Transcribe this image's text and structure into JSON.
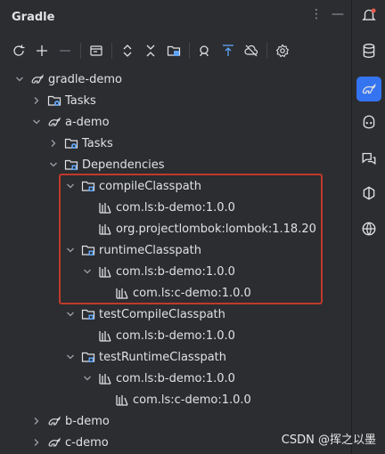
{
  "panel": {
    "title": "Gradle",
    "menu_icon": "more-vertical-icon",
    "minimize_icon": "minimize-icon"
  },
  "toolbar": {
    "buttons": [
      "refresh-icon",
      "add-icon",
      "remove-icon",
      "run-task-icon",
      "expand-all-icon",
      "collapse-all-icon",
      "dependencies-icon",
      "analyze-icon",
      "scroll-to-icon",
      "offline-icon",
      "settings-icon"
    ]
  },
  "tree": [
    {
      "label": "gradle-demo",
      "depth": 0,
      "arrow": "down",
      "icon": "gradle-icon"
    },
    {
      "label": "Tasks",
      "depth": 1,
      "arrow": "right",
      "icon": "tasks-folder-icon"
    },
    {
      "label": "a-demo",
      "depth": 1,
      "arrow": "down",
      "icon": "gradle-icon"
    },
    {
      "label": "Tasks",
      "depth": 2,
      "arrow": "right",
      "icon": "tasks-folder-icon"
    },
    {
      "label": "Dependencies",
      "depth": 2,
      "arrow": "down",
      "icon": "dependencies-folder-icon"
    },
    {
      "label": "compileClasspath",
      "depth": 3,
      "arrow": "down",
      "icon": "dependencies-folder-icon"
    },
    {
      "label": "com.ls:b-demo:1.0.0",
      "depth": 4,
      "arrow": "none",
      "icon": "library-icon"
    },
    {
      "label": "org.projectlombok:lombok:1.18.20",
      "depth": 4,
      "arrow": "none",
      "icon": "library-icon"
    },
    {
      "label": "runtimeClasspath",
      "depth": 3,
      "arrow": "down",
      "icon": "dependencies-folder-icon"
    },
    {
      "label": "com.ls:b-demo:1.0.0",
      "depth": 4,
      "arrow": "down",
      "icon": "library-icon"
    },
    {
      "label": "com.ls:c-demo:1.0.0",
      "depth": 5,
      "arrow": "none",
      "icon": "library-icon"
    },
    {
      "label": "testCompileClasspath",
      "depth": 3,
      "arrow": "down",
      "icon": "dependencies-folder-icon"
    },
    {
      "label": "com.ls:b-demo:1.0.0",
      "depth": 4,
      "arrow": "none",
      "icon": "library-icon"
    },
    {
      "label": "testRuntimeClasspath",
      "depth": 3,
      "arrow": "down",
      "icon": "dependencies-folder-icon"
    },
    {
      "label": "com.ls:b-demo:1.0.0",
      "depth": 4,
      "arrow": "down",
      "icon": "library-icon"
    },
    {
      "label": "com.ls:c-demo:1.0.0",
      "depth": 5,
      "arrow": "none",
      "icon": "library-icon"
    },
    {
      "label": "b-demo",
      "depth": 1,
      "arrow": "right",
      "icon": "gradle-icon"
    },
    {
      "label": "c-demo",
      "depth": 1,
      "arrow": "right",
      "icon": "gradle-icon"
    }
  ],
  "rightbar": {
    "icons": [
      "notifications-icon",
      "database-icon",
      "gradle-icon",
      "copilot-icon",
      "chat-icon",
      "dev-icon",
      "web-icon"
    ],
    "active": "gradle-icon"
  },
  "watermark": "CSDN @挥之以墨",
  "colors": {
    "background": "#2b2d30",
    "text": "#dfe1e5",
    "highlight_border": "#c0392b",
    "active_accent": "#3574f0",
    "icon_blue": "#5fa4f5"
  }
}
